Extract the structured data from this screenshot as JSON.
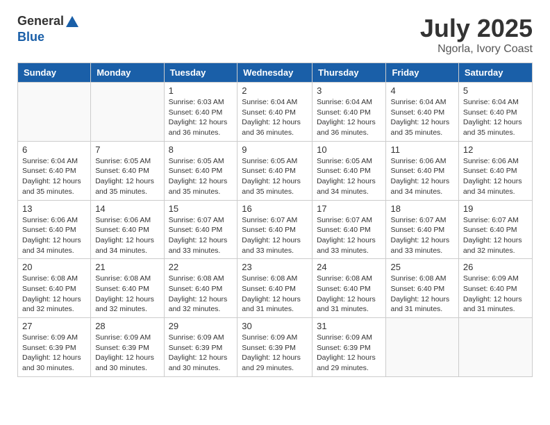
{
  "header": {
    "logo_general": "General",
    "logo_blue": "Blue",
    "month_year": "July 2025",
    "location": "Ngorla, Ivory Coast"
  },
  "calendar": {
    "days_of_week": [
      "Sunday",
      "Monday",
      "Tuesday",
      "Wednesday",
      "Thursday",
      "Friday",
      "Saturday"
    ],
    "weeks": [
      [
        {
          "day": "",
          "info": ""
        },
        {
          "day": "",
          "info": ""
        },
        {
          "day": "1",
          "info": "Sunrise: 6:03 AM\nSunset: 6:40 PM\nDaylight: 12 hours\nand 36 minutes."
        },
        {
          "day": "2",
          "info": "Sunrise: 6:04 AM\nSunset: 6:40 PM\nDaylight: 12 hours\nand 36 minutes."
        },
        {
          "day": "3",
          "info": "Sunrise: 6:04 AM\nSunset: 6:40 PM\nDaylight: 12 hours\nand 36 minutes."
        },
        {
          "day": "4",
          "info": "Sunrise: 6:04 AM\nSunset: 6:40 PM\nDaylight: 12 hours\nand 35 minutes."
        },
        {
          "day": "5",
          "info": "Sunrise: 6:04 AM\nSunset: 6:40 PM\nDaylight: 12 hours\nand 35 minutes."
        }
      ],
      [
        {
          "day": "6",
          "info": "Sunrise: 6:04 AM\nSunset: 6:40 PM\nDaylight: 12 hours\nand 35 minutes."
        },
        {
          "day": "7",
          "info": "Sunrise: 6:05 AM\nSunset: 6:40 PM\nDaylight: 12 hours\nand 35 minutes."
        },
        {
          "day": "8",
          "info": "Sunrise: 6:05 AM\nSunset: 6:40 PM\nDaylight: 12 hours\nand 35 minutes."
        },
        {
          "day": "9",
          "info": "Sunrise: 6:05 AM\nSunset: 6:40 PM\nDaylight: 12 hours\nand 35 minutes."
        },
        {
          "day": "10",
          "info": "Sunrise: 6:05 AM\nSunset: 6:40 PM\nDaylight: 12 hours\nand 34 minutes."
        },
        {
          "day": "11",
          "info": "Sunrise: 6:06 AM\nSunset: 6:40 PM\nDaylight: 12 hours\nand 34 minutes."
        },
        {
          "day": "12",
          "info": "Sunrise: 6:06 AM\nSunset: 6:40 PM\nDaylight: 12 hours\nand 34 minutes."
        }
      ],
      [
        {
          "day": "13",
          "info": "Sunrise: 6:06 AM\nSunset: 6:40 PM\nDaylight: 12 hours\nand 34 minutes."
        },
        {
          "day": "14",
          "info": "Sunrise: 6:06 AM\nSunset: 6:40 PM\nDaylight: 12 hours\nand 34 minutes."
        },
        {
          "day": "15",
          "info": "Sunrise: 6:07 AM\nSunset: 6:40 PM\nDaylight: 12 hours\nand 33 minutes."
        },
        {
          "day": "16",
          "info": "Sunrise: 6:07 AM\nSunset: 6:40 PM\nDaylight: 12 hours\nand 33 minutes."
        },
        {
          "day": "17",
          "info": "Sunrise: 6:07 AM\nSunset: 6:40 PM\nDaylight: 12 hours\nand 33 minutes."
        },
        {
          "day": "18",
          "info": "Sunrise: 6:07 AM\nSunset: 6:40 PM\nDaylight: 12 hours\nand 33 minutes."
        },
        {
          "day": "19",
          "info": "Sunrise: 6:07 AM\nSunset: 6:40 PM\nDaylight: 12 hours\nand 32 minutes."
        }
      ],
      [
        {
          "day": "20",
          "info": "Sunrise: 6:08 AM\nSunset: 6:40 PM\nDaylight: 12 hours\nand 32 minutes."
        },
        {
          "day": "21",
          "info": "Sunrise: 6:08 AM\nSunset: 6:40 PM\nDaylight: 12 hours\nand 32 minutes."
        },
        {
          "day": "22",
          "info": "Sunrise: 6:08 AM\nSunset: 6:40 PM\nDaylight: 12 hours\nand 32 minutes."
        },
        {
          "day": "23",
          "info": "Sunrise: 6:08 AM\nSunset: 6:40 PM\nDaylight: 12 hours\nand 31 minutes."
        },
        {
          "day": "24",
          "info": "Sunrise: 6:08 AM\nSunset: 6:40 PM\nDaylight: 12 hours\nand 31 minutes."
        },
        {
          "day": "25",
          "info": "Sunrise: 6:08 AM\nSunset: 6:40 PM\nDaylight: 12 hours\nand 31 minutes."
        },
        {
          "day": "26",
          "info": "Sunrise: 6:09 AM\nSunset: 6:40 PM\nDaylight: 12 hours\nand 31 minutes."
        }
      ],
      [
        {
          "day": "27",
          "info": "Sunrise: 6:09 AM\nSunset: 6:39 PM\nDaylight: 12 hours\nand 30 minutes."
        },
        {
          "day": "28",
          "info": "Sunrise: 6:09 AM\nSunset: 6:39 PM\nDaylight: 12 hours\nand 30 minutes."
        },
        {
          "day": "29",
          "info": "Sunrise: 6:09 AM\nSunset: 6:39 PM\nDaylight: 12 hours\nand 30 minutes."
        },
        {
          "day": "30",
          "info": "Sunrise: 6:09 AM\nSunset: 6:39 PM\nDaylight: 12 hours\nand 29 minutes."
        },
        {
          "day": "31",
          "info": "Sunrise: 6:09 AM\nSunset: 6:39 PM\nDaylight: 12 hours\nand 29 minutes."
        },
        {
          "day": "",
          "info": ""
        },
        {
          "day": "",
          "info": ""
        }
      ]
    ]
  }
}
